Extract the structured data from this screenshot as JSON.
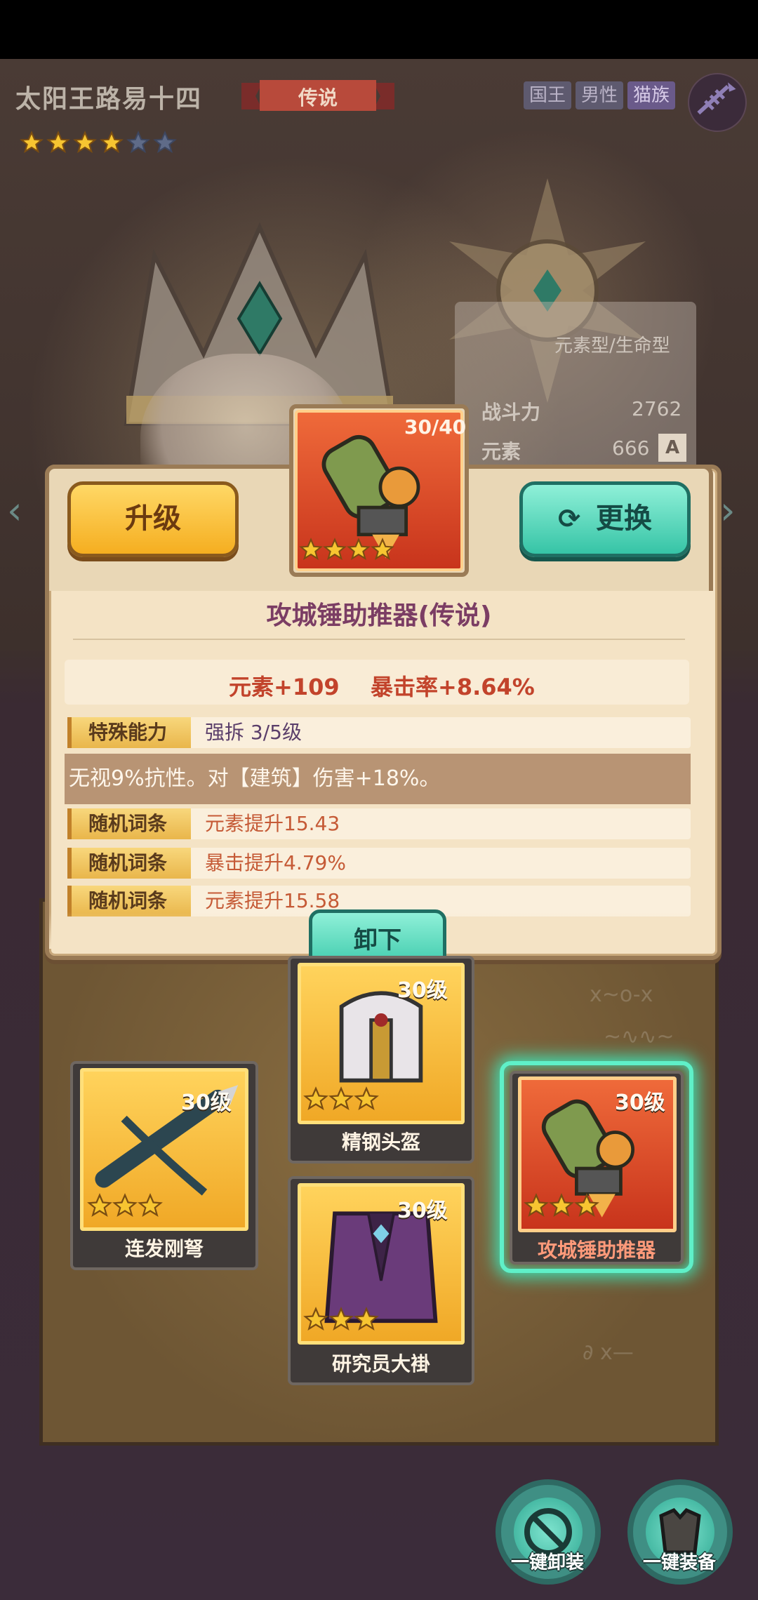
{
  "hero": {
    "name": "太阳王路易十四",
    "rarity": "传说",
    "stars_filled": 4,
    "stars_total": 6,
    "tags": [
      "国王",
      "男性",
      "猫族"
    ],
    "element_type": "元素型/生命型",
    "power_label": "战斗力",
    "power_value": "2762",
    "element_label": "元素",
    "element_value": "666",
    "element_grade": "A"
  },
  "detail": {
    "upgrade_label": "升级",
    "replace_label": "更换",
    "level": "30/40",
    "stars": 4,
    "title": "攻城锤助推器(传说)",
    "main_stat_1": "元素+109",
    "main_stat_2": "暴击率+8.64%",
    "special_label": "特殊能力",
    "special_value": "强拆  3/5级",
    "special_desc": "无视9%抗性。对【建筑】伤害+18%。",
    "random_rows": [
      {
        "label": "随机词条",
        "value": "元素提升15.43"
      },
      {
        "label": "随机词条",
        "value": "暴击提升4.79%"
      },
      {
        "label": "随机词条",
        "value": "元素提升15.58"
      }
    ]
  },
  "unequip_label": "卸下",
  "slots": {
    "helmet": {
      "level": "30级",
      "name": "精钢头盔",
      "stars": 3
    },
    "crossbow": {
      "level": "30级",
      "name": "连发刚弩",
      "stars": 3
    },
    "booster": {
      "level": "30级",
      "name": "攻城锤助推器",
      "stars": 3
    },
    "coat": {
      "level": "30级",
      "name": "研究员大褂",
      "stars": 3
    }
  },
  "actions": {
    "unequip_all": "一键卸装",
    "equip_all": "一键装备"
  },
  "colors": {
    "accent_teal": "#3bc9aa",
    "accent_gold": "#f5ae20",
    "legend_red": "#c8341c"
  }
}
